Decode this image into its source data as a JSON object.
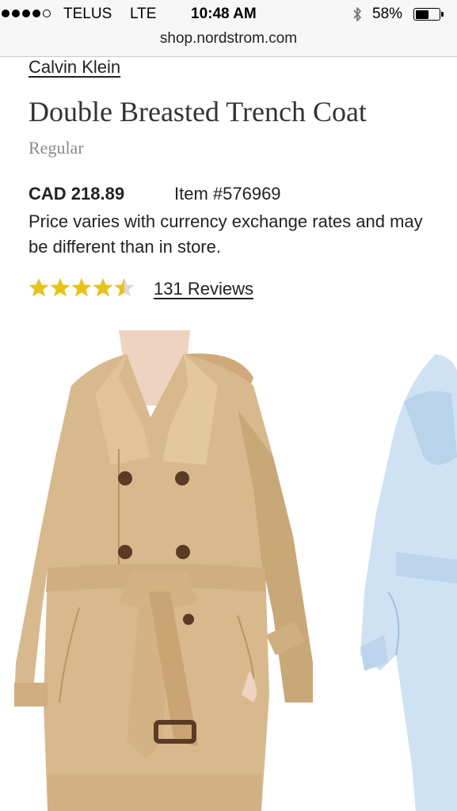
{
  "status_bar": {
    "carrier": "TELUS",
    "network": "LTE",
    "time": "10:48 AM",
    "battery_percent": "58%",
    "battery_level": 0.58,
    "signal_bars_filled": 4,
    "signal_bars_total": 5
  },
  "browser": {
    "url": "shop.nordstrom.com"
  },
  "product": {
    "brand": "Calvin Klein",
    "title": "Double Breasted Trench Coat",
    "fit": "Regular",
    "price": "CAD 218.89",
    "item_number": "Item #576969",
    "price_note": "Price varies with currency exchange rates and may be different than in store.",
    "rating": 4.5,
    "rating_max": 5,
    "reviews_label": "131 Reviews"
  },
  "images": {
    "main_color": "camel",
    "alt_color": "light blue"
  },
  "colors": {
    "star_filled": "#e8c21c",
    "star_empty": "#d9d9d9",
    "camel": "#d7b88c",
    "light_blue": "#cfe2f3"
  },
  "icons": {
    "bluetooth": "bluetooth-icon",
    "battery": "battery-icon",
    "star": "star-icon"
  }
}
